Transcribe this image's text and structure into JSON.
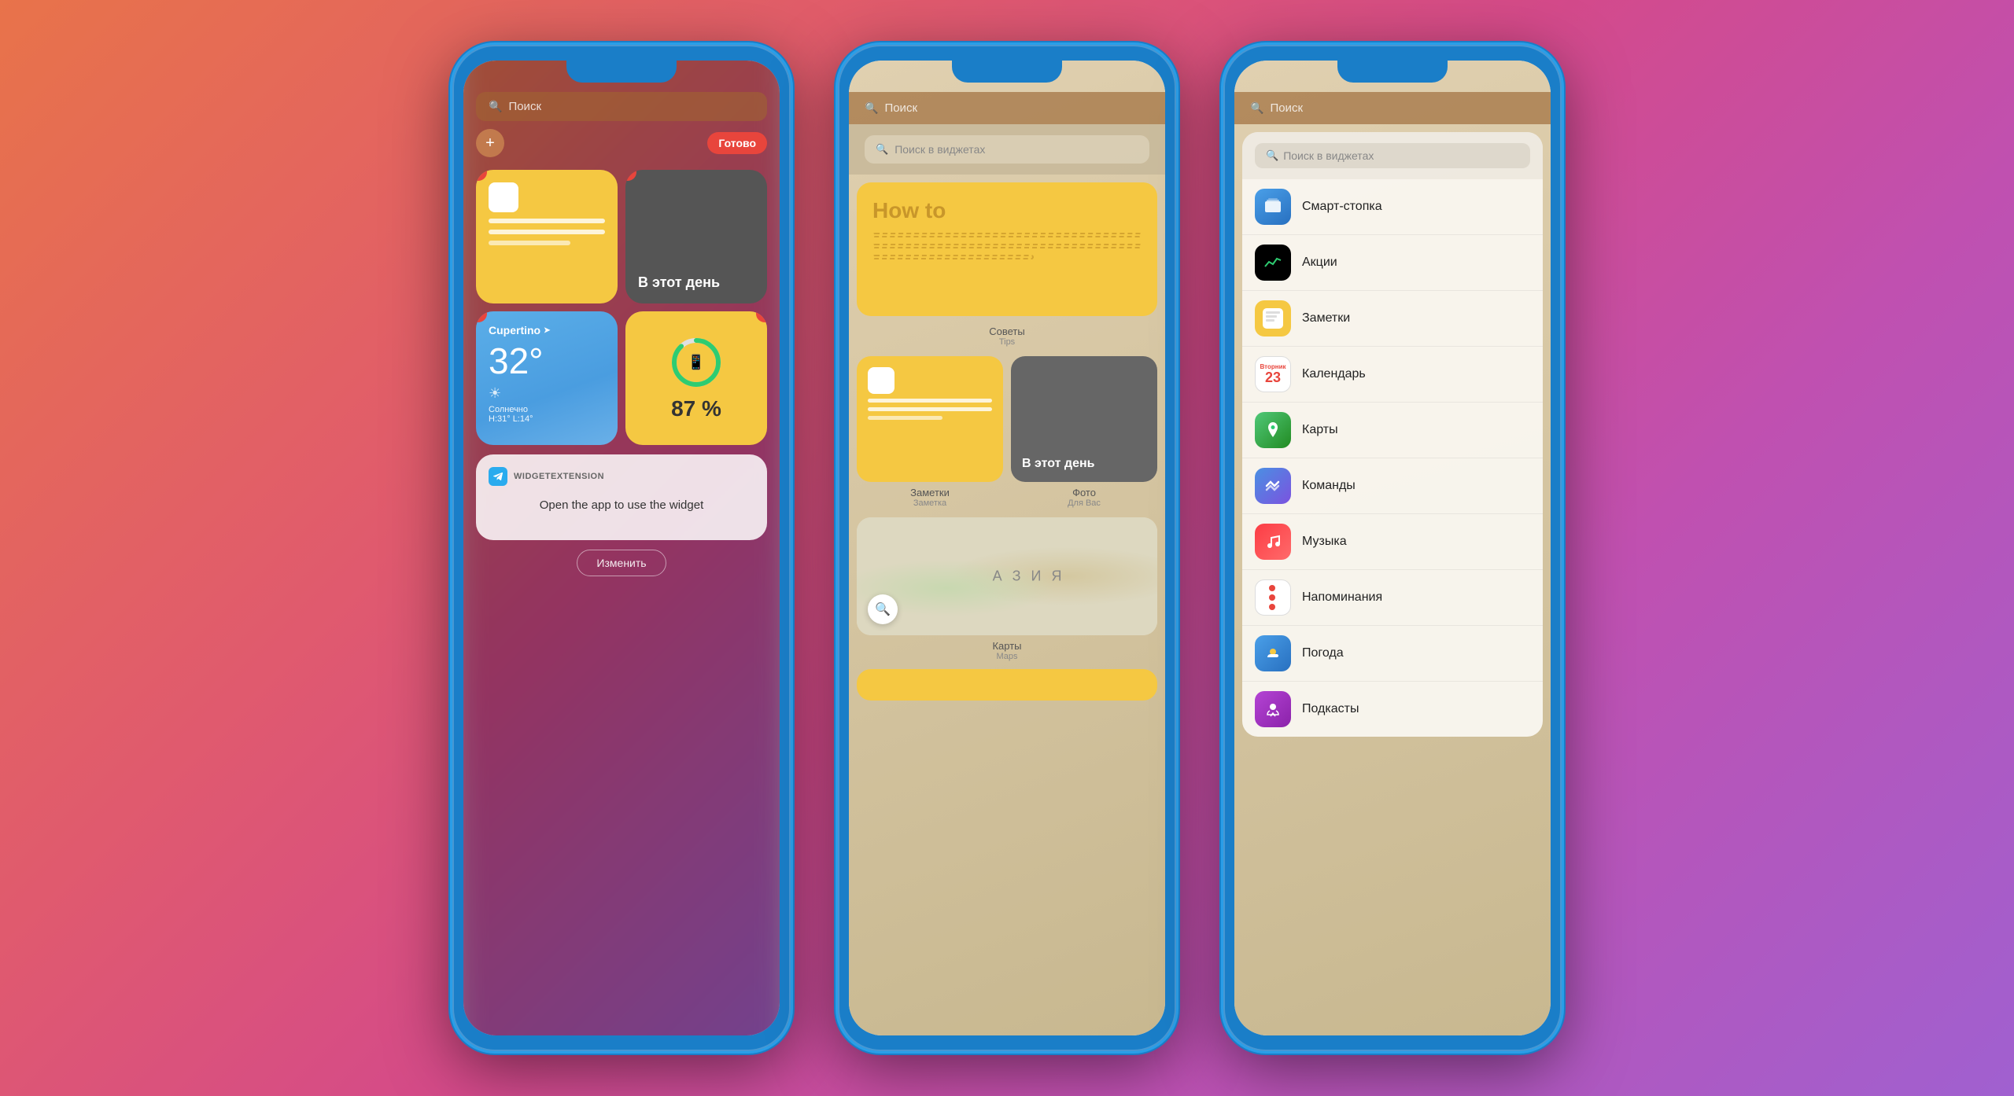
{
  "background": {
    "gradient": "linear-gradient(135deg, #e8734a, #d44a8a, #a060d0)"
  },
  "phone1": {
    "add_button": "+",
    "done_button": "Готово",
    "search_placeholder": "Поиск",
    "notes_widget": {
      "label": "Заметки"
    },
    "today_widget": {
      "label": "В этот день"
    },
    "weather_widget": {
      "city": "Cupertino",
      "temp": "32°",
      "description": "Солнечно",
      "high_low": "H:31° L:14°"
    },
    "battery_widget": {
      "percent": "87 %",
      "value": 87
    },
    "telegram_widget": {
      "title": "WIDGETEXTENSION",
      "body": "Open the app to use the widget",
      "edit_button": "Изменить"
    }
  },
  "phone2": {
    "search_placeholder": "Поиск",
    "widget_search_placeholder": "Поиск в виджетах",
    "tips_widget": {
      "howto_text": "How to",
      "label": "Советы",
      "sublabel": "Tips"
    },
    "notes_small_widget": {
      "label": "Заметки",
      "sublabel": "Заметка"
    },
    "photo_widget": {
      "text": "В этот день",
      "label": "Фото",
      "sublabel": "Для Вас"
    },
    "map_widget": {
      "asia_text": "А З И Я",
      "label": "Карты",
      "sublabel": "Maps"
    }
  },
  "phone3": {
    "search_placeholder": "Поиск",
    "widget_search_placeholder": "Поиск в виджетах",
    "apps": [
      {
        "name": "Смарт-стопка",
        "icon_type": "smartstack"
      },
      {
        "name": "Акции",
        "icon_type": "stocks"
      },
      {
        "name": "Заметки",
        "icon_type": "notes"
      },
      {
        "name": "Календарь",
        "icon_type": "calendar",
        "date": "23"
      },
      {
        "name": "Карты",
        "icon_type": "maps"
      },
      {
        "name": "Команды",
        "icon_type": "shortcuts"
      },
      {
        "name": "Музыка",
        "icon_type": "music"
      },
      {
        "name": "Напоминания",
        "icon_type": "reminders"
      },
      {
        "name": "Погода",
        "icon_type": "weather"
      },
      {
        "name": "Подкасты",
        "icon_type": "podcasts"
      }
    ]
  }
}
